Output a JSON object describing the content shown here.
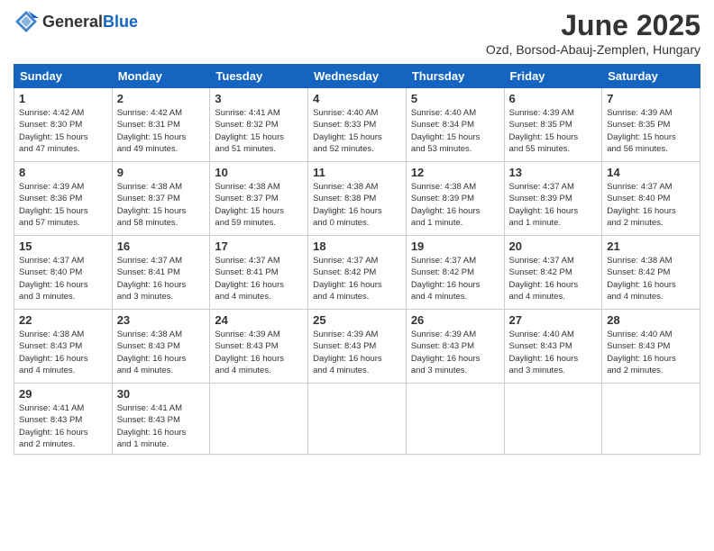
{
  "header": {
    "logo_general": "General",
    "logo_blue": "Blue",
    "title": "June 2025",
    "location": "Ozd, Borsod-Abauj-Zemplen, Hungary"
  },
  "days_of_week": [
    "Sunday",
    "Monday",
    "Tuesday",
    "Wednesday",
    "Thursday",
    "Friday",
    "Saturday"
  ],
  "weeks": [
    [
      {
        "day": "1",
        "info": "Sunrise: 4:42 AM\nSunset: 8:30 PM\nDaylight: 15 hours\nand 47 minutes."
      },
      {
        "day": "2",
        "info": "Sunrise: 4:42 AM\nSunset: 8:31 PM\nDaylight: 15 hours\nand 49 minutes."
      },
      {
        "day": "3",
        "info": "Sunrise: 4:41 AM\nSunset: 8:32 PM\nDaylight: 15 hours\nand 51 minutes."
      },
      {
        "day": "4",
        "info": "Sunrise: 4:40 AM\nSunset: 8:33 PM\nDaylight: 15 hours\nand 52 minutes."
      },
      {
        "day": "5",
        "info": "Sunrise: 4:40 AM\nSunset: 8:34 PM\nDaylight: 15 hours\nand 53 minutes."
      },
      {
        "day": "6",
        "info": "Sunrise: 4:39 AM\nSunset: 8:35 PM\nDaylight: 15 hours\nand 55 minutes."
      },
      {
        "day": "7",
        "info": "Sunrise: 4:39 AM\nSunset: 8:35 PM\nDaylight: 15 hours\nand 56 minutes."
      }
    ],
    [
      {
        "day": "8",
        "info": "Sunrise: 4:39 AM\nSunset: 8:36 PM\nDaylight: 15 hours\nand 57 minutes."
      },
      {
        "day": "9",
        "info": "Sunrise: 4:38 AM\nSunset: 8:37 PM\nDaylight: 15 hours\nand 58 minutes."
      },
      {
        "day": "10",
        "info": "Sunrise: 4:38 AM\nSunset: 8:37 PM\nDaylight: 15 hours\nand 59 minutes."
      },
      {
        "day": "11",
        "info": "Sunrise: 4:38 AM\nSunset: 8:38 PM\nDaylight: 16 hours\nand 0 minutes."
      },
      {
        "day": "12",
        "info": "Sunrise: 4:38 AM\nSunset: 8:39 PM\nDaylight: 16 hours\nand 1 minute."
      },
      {
        "day": "13",
        "info": "Sunrise: 4:37 AM\nSunset: 8:39 PM\nDaylight: 16 hours\nand 1 minute."
      },
      {
        "day": "14",
        "info": "Sunrise: 4:37 AM\nSunset: 8:40 PM\nDaylight: 16 hours\nand 2 minutes."
      }
    ],
    [
      {
        "day": "15",
        "info": "Sunrise: 4:37 AM\nSunset: 8:40 PM\nDaylight: 16 hours\nand 3 minutes."
      },
      {
        "day": "16",
        "info": "Sunrise: 4:37 AM\nSunset: 8:41 PM\nDaylight: 16 hours\nand 3 minutes."
      },
      {
        "day": "17",
        "info": "Sunrise: 4:37 AM\nSunset: 8:41 PM\nDaylight: 16 hours\nand 4 minutes."
      },
      {
        "day": "18",
        "info": "Sunrise: 4:37 AM\nSunset: 8:42 PM\nDaylight: 16 hours\nand 4 minutes."
      },
      {
        "day": "19",
        "info": "Sunrise: 4:37 AM\nSunset: 8:42 PM\nDaylight: 16 hours\nand 4 minutes."
      },
      {
        "day": "20",
        "info": "Sunrise: 4:37 AM\nSunset: 8:42 PM\nDaylight: 16 hours\nand 4 minutes."
      },
      {
        "day": "21",
        "info": "Sunrise: 4:38 AM\nSunset: 8:42 PM\nDaylight: 16 hours\nand 4 minutes."
      }
    ],
    [
      {
        "day": "22",
        "info": "Sunrise: 4:38 AM\nSunset: 8:43 PM\nDaylight: 16 hours\nand 4 minutes."
      },
      {
        "day": "23",
        "info": "Sunrise: 4:38 AM\nSunset: 8:43 PM\nDaylight: 16 hours\nand 4 minutes."
      },
      {
        "day": "24",
        "info": "Sunrise: 4:39 AM\nSunset: 8:43 PM\nDaylight: 16 hours\nand 4 minutes."
      },
      {
        "day": "25",
        "info": "Sunrise: 4:39 AM\nSunset: 8:43 PM\nDaylight: 16 hours\nand 4 minutes."
      },
      {
        "day": "26",
        "info": "Sunrise: 4:39 AM\nSunset: 8:43 PM\nDaylight: 16 hours\nand 3 minutes."
      },
      {
        "day": "27",
        "info": "Sunrise: 4:40 AM\nSunset: 8:43 PM\nDaylight: 16 hours\nand 3 minutes."
      },
      {
        "day": "28",
        "info": "Sunrise: 4:40 AM\nSunset: 8:43 PM\nDaylight: 16 hours\nand 2 minutes."
      }
    ],
    [
      {
        "day": "29",
        "info": "Sunrise: 4:41 AM\nSunset: 8:43 PM\nDaylight: 16 hours\nand 2 minutes."
      },
      {
        "day": "30",
        "info": "Sunrise: 4:41 AM\nSunset: 8:43 PM\nDaylight: 16 hours\nand 1 minute."
      },
      {
        "day": "",
        "info": ""
      },
      {
        "day": "",
        "info": ""
      },
      {
        "day": "",
        "info": ""
      },
      {
        "day": "",
        "info": ""
      },
      {
        "day": "",
        "info": ""
      }
    ]
  ]
}
